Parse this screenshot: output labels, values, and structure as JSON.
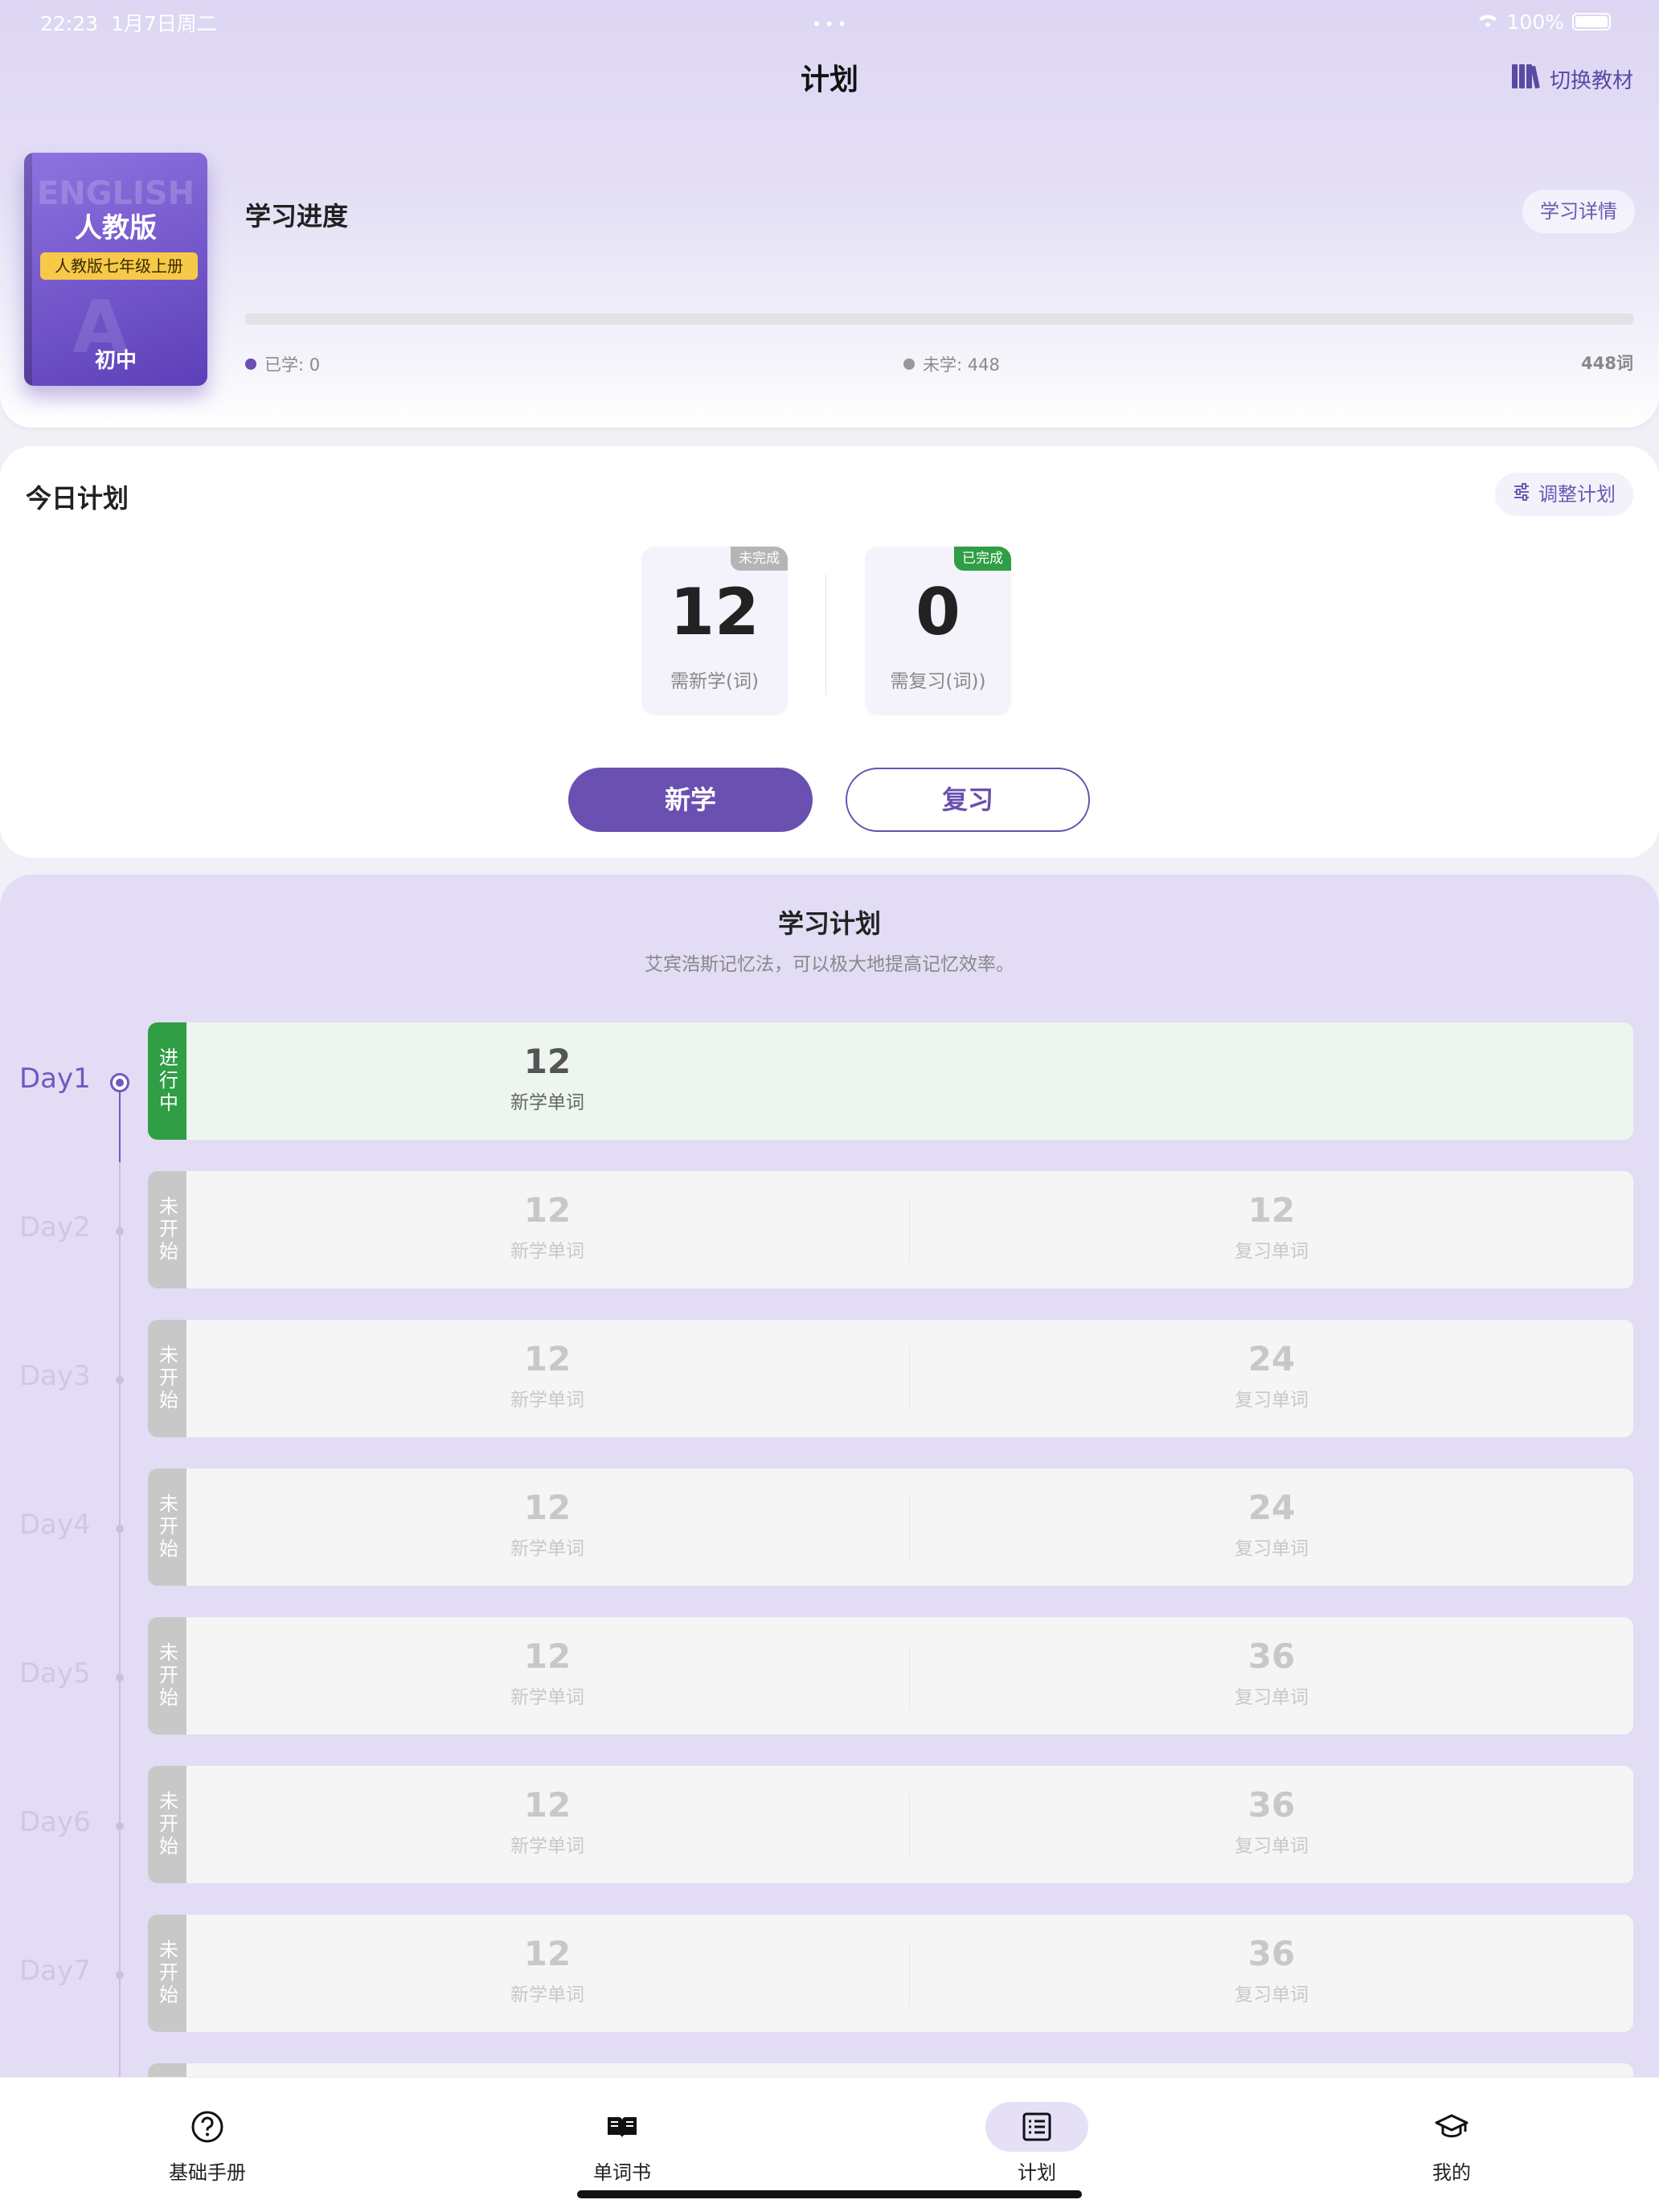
{
  "status_bar": {
    "time": "22:23",
    "date": "1月7日周二",
    "battery": "100%"
  },
  "header": {
    "title": "计划",
    "switch_label": "切换教材"
  },
  "book": {
    "watermark": "ENGLISH",
    "name": "人教版",
    "tag": "人教版七年级上册",
    "level": "初中"
  },
  "progress": {
    "title": "学习进度",
    "detail_button": "学习详情",
    "learned_label": "已学: 0",
    "unlearned_label": "未学: 448",
    "total_label": "448词",
    "learned_fraction": 0,
    "learned_color": "#6a50b0",
    "unlearned_color": "#999999"
  },
  "today": {
    "title": "今日计划",
    "adjust_button": "调整计划",
    "new_card": {
      "count": "12",
      "label": "需新学(词)",
      "badge": "未完成",
      "badge_color": "#b5b5b5"
    },
    "review_card": {
      "count": "0",
      "label": "需复习(词))",
      "badge": "已完成",
      "badge_color": "#2f9e44"
    },
    "new_button": "新学",
    "review_button": "复习"
  },
  "plan": {
    "title": "学习计划",
    "subtitle": "艾宾浩斯记忆法，可以极大地提高记忆效率。",
    "days": [
      {
        "day": "Day1",
        "status": "进行中",
        "new_count": "12",
        "new_label": "新学单词",
        "review_count": "",
        "review_label": "",
        "active": true
      },
      {
        "day": "Day2",
        "status": "未开始",
        "new_count": "12",
        "new_label": "新学单词",
        "review_count": "12",
        "review_label": "复习单词",
        "active": false
      },
      {
        "day": "Day3",
        "status": "未开始",
        "new_count": "12",
        "new_label": "新学单词",
        "review_count": "24",
        "review_label": "复习单词",
        "active": false
      },
      {
        "day": "Day4",
        "status": "未开始",
        "new_count": "12",
        "new_label": "新学单词",
        "review_count": "24",
        "review_label": "复习单词",
        "active": false
      },
      {
        "day": "Day5",
        "status": "未开始",
        "new_count": "12",
        "new_label": "新学单词",
        "review_count": "36",
        "review_label": "复习单词",
        "active": false
      },
      {
        "day": "Day6",
        "status": "未开始",
        "new_count": "12",
        "new_label": "新学单词",
        "review_count": "36",
        "review_label": "复习单词",
        "active": false
      },
      {
        "day": "Day7",
        "status": "未开始",
        "new_count": "12",
        "new_label": "新学单词",
        "review_count": "36",
        "review_label": "复习单词",
        "active": false
      }
    ]
  },
  "tabs": [
    {
      "label": "基础手册",
      "icon": "help-circle-icon",
      "selected": false
    },
    {
      "label": "单词书",
      "icon": "open-book-icon",
      "selected": false
    },
    {
      "label": "计划",
      "icon": "list-icon",
      "selected": true
    },
    {
      "label": "我的",
      "icon": "graduation-cap-icon",
      "selected": false
    }
  ]
}
